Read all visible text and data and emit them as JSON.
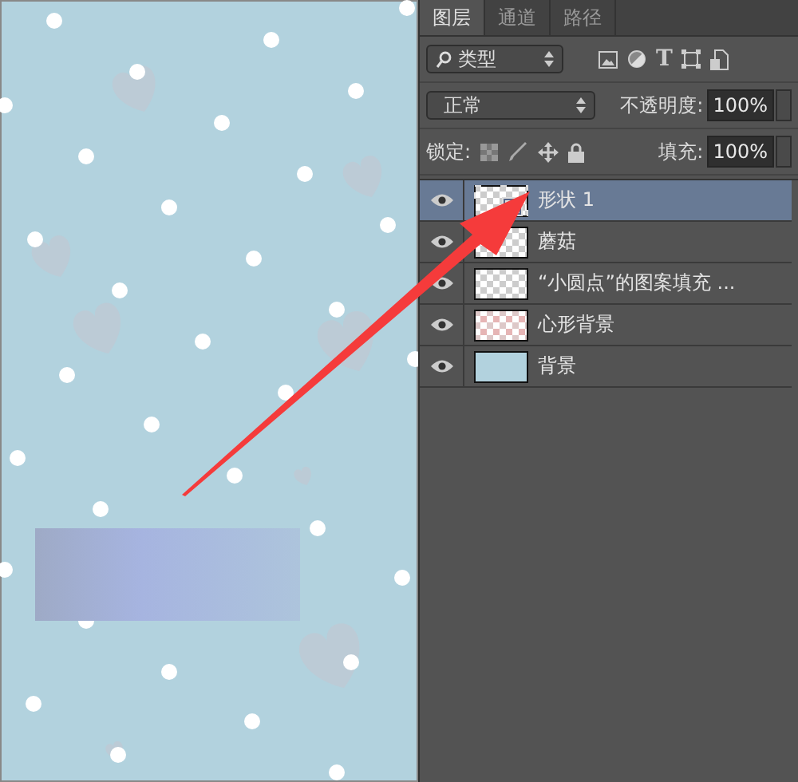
{
  "tabs": [
    {
      "label": "图层",
      "selected": true
    },
    {
      "label": "通道",
      "selected": false
    },
    {
      "label": "路径",
      "selected": false
    }
  ],
  "filter": {
    "value": "类型",
    "text_icon": "T"
  },
  "blend_mode": {
    "value": "正常"
  },
  "opacity": {
    "label": "不透明度:",
    "value": "100%"
  },
  "lock": {
    "label": "锁定:"
  },
  "fill": {
    "label": "填充:",
    "value": "100%"
  },
  "layers": [
    {
      "name": "形状 1",
      "visible": true,
      "selected": true,
      "kind": "vector"
    },
    {
      "name": "蘑菇",
      "visible": true,
      "selected": false,
      "kind": "transparent"
    },
    {
      "name": "“小圆点”的图案填充 ...",
      "visible": true,
      "selected": false,
      "kind": "transparent"
    },
    {
      "name": "心形背景",
      "visible": true,
      "selected": false,
      "kind": "tinted"
    },
    {
      "name": "背景",
      "visible": true,
      "selected": false,
      "kind": "solid"
    }
  ]
}
